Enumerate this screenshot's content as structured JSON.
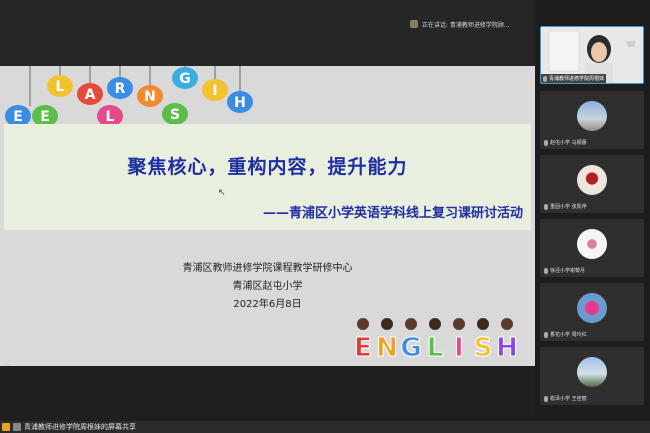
{
  "speaking": {
    "text": "正在讲话: 青浦教师进修学院顾..."
  },
  "slide": {
    "balloon_letters": [
      "E",
      "L",
      "E",
      "A",
      "R",
      "N",
      "G",
      "L",
      "I",
      "S",
      "H"
    ],
    "title": "聚焦核心，重构内容，提升能力",
    "subtitle": "——青浦区小学英语学科线上复习课研讨活动",
    "org_line1": "青浦区教师进修学院课程教学研修中心",
    "org_line2": "青浦区赵屯小学",
    "date": "2022年6月8日",
    "kids_letters": [
      "E",
      "N",
      "G",
      "L",
      "I",
      "S",
      "H"
    ]
  },
  "status": {
    "share_text": "青浦教师进修学院周根妹的屏幕共享"
  },
  "participants": [
    {
      "label": "青浦教师进修学院周根妹",
      "active": true
    },
    {
      "label": "赵屯小学 马顺蕾",
      "active": false
    },
    {
      "label": "重固小学 张凯萍",
      "active": false
    },
    {
      "label": "徐泾小学谢黎月",
      "active": false
    },
    {
      "label": "香花小学 周玲红",
      "active": false
    },
    {
      "label": "崧泽小学 王佳丽",
      "active": false
    }
  ],
  "colors": {
    "title": "#1f2ea0",
    "band": "#e9efdf",
    "active_border": "#3a9bdc",
    "share_icon": "#f0a020"
  }
}
